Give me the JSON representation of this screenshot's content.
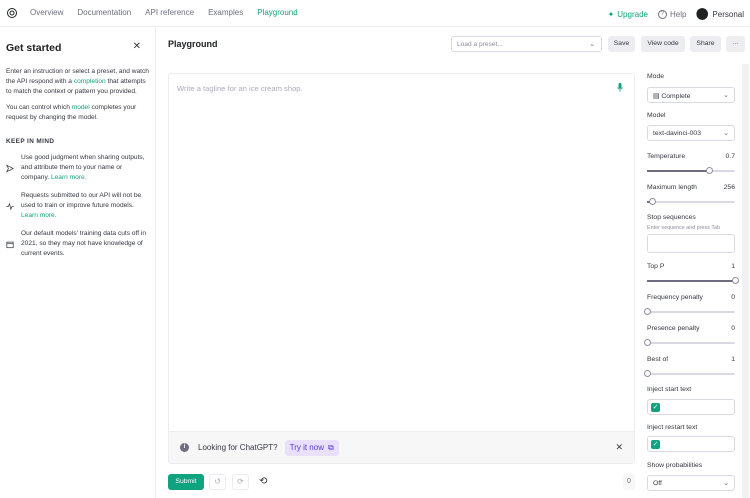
{
  "nav": {
    "links": [
      "Overview",
      "Documentation",
      "API reference",
      "Examples",
      "Playground"
    ],
    "active": "Playground",
    "upgrade": "Upgrade",
    "help": "Help",
    "personal": "Personal"
  },
  "sidebar": {
    "title": "Get started",
    "intro_a": "Enter an instruction or select a preset, and watch the API respond with a ",
    "intro_link": "completion",
    "intro_b": " that attempts to match the context or pattern you provided.",
    "model_a": "You can control which ",
    "model_link": "model",
    "model_b": " completes your request by changing the model.",
    "keep_heading": "KEEP IN MIND",
    "tips": [
      {
        "icon": "send-icon",
        "text": "Use good judgment when sharing outputs, and attribute them to your name or company. ",
        "link": "Learn more."
      },
      {
        "icon": "activity-icon",
        "text": "Requests submitted to our API will not be used to train or improve future models. ",
        "link": "Learn more."
      },
      {
        "icon": "calendar-icon",
        "text": "Our default models' training data cuts off in 2021, so they may not have knowledge of current events.",
        "link": ""
      }
    ]
  },
  "header": {
    "title": "Playground",
    "preset_placeholder": "Load a preset...",
    "save": "Save",
    "view_code": "View code",
    "share": "Share",
    "more": "···"
  },
  "editor": {
    "placeholder": "Write a tagline for an ice cream shop.",
    "banner_text": "Looking for ChatGPT?",
    "banner_link": "Try it now",
    "submit": "Submit",
    "token_count": "0"
  },
  "settings": {
    "mode_label": "Mode",
    "mode_value": "Complete",
    "model_label": "Model",
    "model_value": "text-davinci-003",
    "temperature_label": "Temperature",
    "temperature_value": "0.7",
    "temperature_level": 0.7,
    "max_length_label": "Maximum length",
    "max_length_value": "256",
    "max_length_level": 0.06,
    "stop_label": "Stop sequences",
    "stop_hint": "Enter sequence and press Tab",
    "top_p_label": "Top P",
    "top_p_value": "1",
    "top_p_level": 1,
    "freq_label": "Frequency penalty",
    "freq_value": "0",
    "freq_level": 0,
    "presence_label": "Presence penalty",
    "presence_value": "0",
    "presence_level": 0,
    "best_of_label": "Best of",
    "best_of_value": "1",
    "best_of_level": 0,
    "inject_start_label": "Inject start text",
    "inject_start_checked": true,
    "inject_restart_label": "Inject restart text",
    "inject_restart_checked": true,
    "show_prob_label": "Show probabilities",
    "show_prob_value": "Off"
  },
  "colors": {
    "accent": "#10a37f",
    "link_purple": "#5436da",
    "banner_bg": "#e8e0fc"
  }
}
